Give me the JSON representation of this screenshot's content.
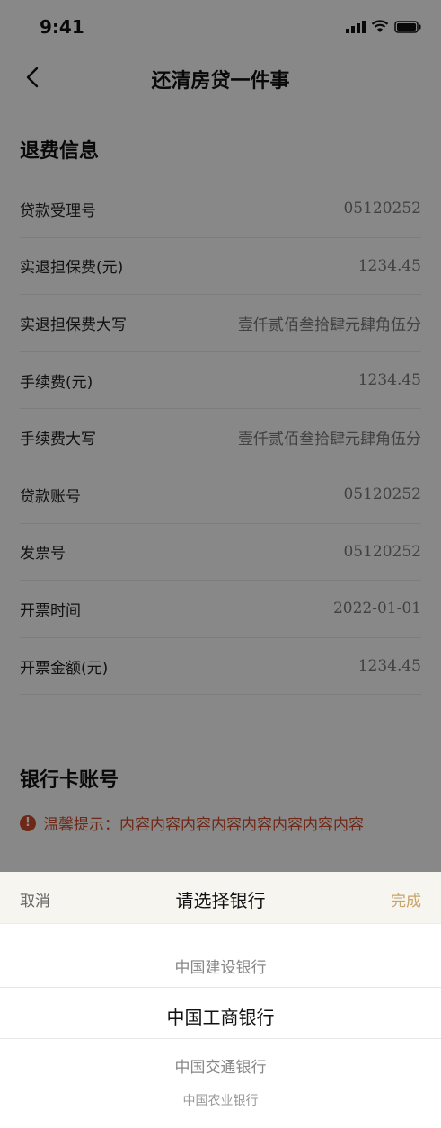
{
  "status_bar": {
    "time": "9:41"
  },
  "nav": {
    "title": "还清房贷一件事"
  },
  "refund_section": {
    "title": "退费信息",
    "rows": [
      {
        "label": "贷款受理号",
        "value": "05120252"
      },
      {
        "label": "实退担保费(元)",
        "value": "1234.45"
      },
      {
        "label": "实退担保费大写",
        "value": "壹仟贰佰叁拾肆元肆角伍分"
      },
      {
        "label": "手续费(元)",
        "value": "1234.45"
      },
      {
        "label": "手续费大写",
        "value": "壹仟贰佰叁拾肆元肆角伍分"
      },
      {
        "label": "贷款账号",
        "value": "05120252"
      },
      {
        "label": "发票号",
        "value": "05120252"
      },
      {
        "label": "开票时间",
        "value": "2022-01-01"
      },
      {
        "label": "开票金额(元)",
        "value": "1234.45"
      }
    ]
  },
  "bank_section": {
    "title": "银行卡账号",
    "tip": "温馨提示：内容内容内容内容内容内容内容内容",
    "tip_color": "#c94a2a"
  },
  "picker": {
    "cancel": "取消",
    "title": "请选择银行",
    "done": "完成",
    "accent_color": "#c9a46b",
    "options": [
      "中国建设银行",
      "中国工商银行",
      "中国交通银行",
      "中国农业银行"
    ],
    "selected": "中国工商银行"
  }
}
